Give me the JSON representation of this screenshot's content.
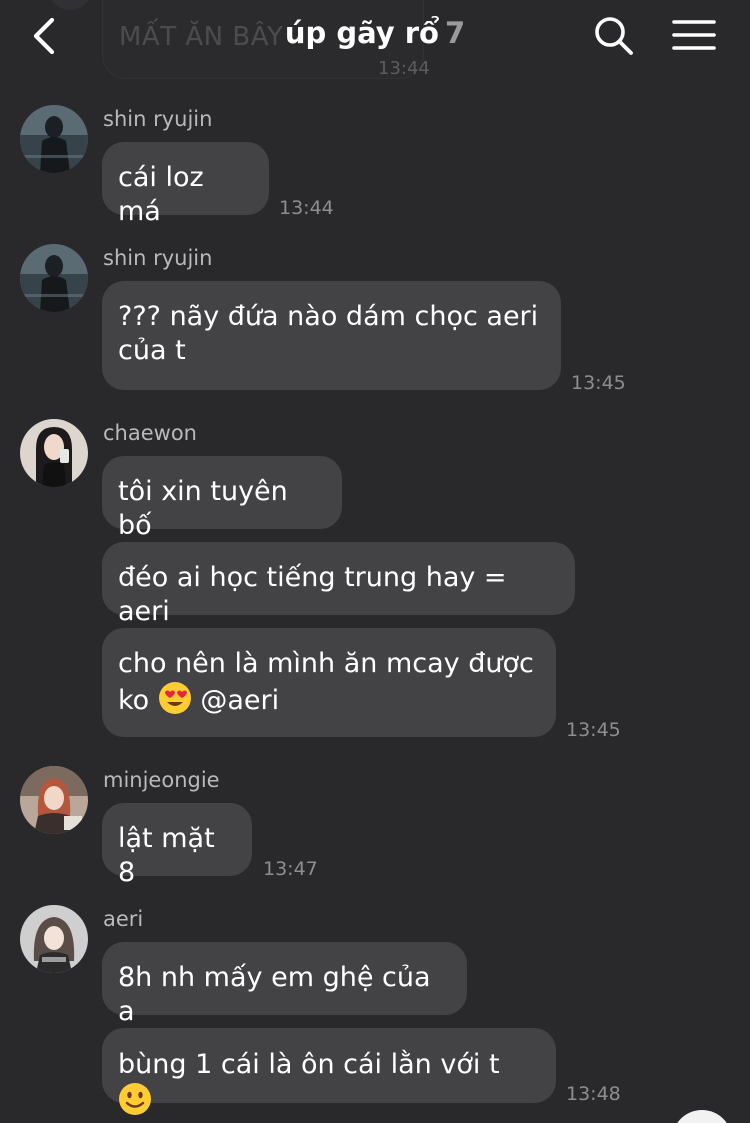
{
  "header": {
    "title": "úp gãy rổ",
    "member_count": "7",
    "ghost_message": "MẤT ĂN BÂY",
    "ghost_time": "13:44"
  },
  "icons": {
    "back": "chevron-left-icon",
    "search": "search-icon",
    "menu": "hamburger-menu-icon"
  },
  "messages": [
    {
      "sender": "shin ryujin",
      "avatar": "avatar-shin-ryujin",
      "bubbles": [
        "cái loz má"
      ],
      "time": "13:44"
    },
    {
      "sender": "shin ryujin",
      "avatar": "avatar-shin-ryujin",
      "bubbles": [
        "??? nãy đứa nào dám chọc aeri",
        "của t"
      ],
      "time": "13:45"
    },
    {
      "sender": "chaewon",
      "avatar": "avatar-chaewon",
      "bubbles": [
        "tôi xin tuyên bố",
        "đéo ai học tiếng trung hay = aeri",
        "cho nên là mình ăn mcay được",
        "ko",
        "@aeri"
      ],
      "time": "13:45"
    },
    {
      "sender": "minjeongie",
      "avatar": "avatar-minjeongie",
      "bubbles": [
        "lật mặt 8"
      ],
      "time": "13:47"
    },
    {
      "sender": "aeri",
      "avatar": "avatar-aeri",
      "bubbles": [
        "8h nh mấy em ghệ của a",
        "bùng 1 cái là ôn cái lằn với t"
      ],
      "time": "13:48"
    }
  ],
  "emojis": {
    "heart_eyes": "heart-eyes-emoji",
    "smile": "slightly-smiling-emoji"
  },
  "colors": {
    "background": "#29292c",
    "bubble": "#434346",
    "text": "#ffffff",
    "secondary_text": "#8e8e92"
  }
}
